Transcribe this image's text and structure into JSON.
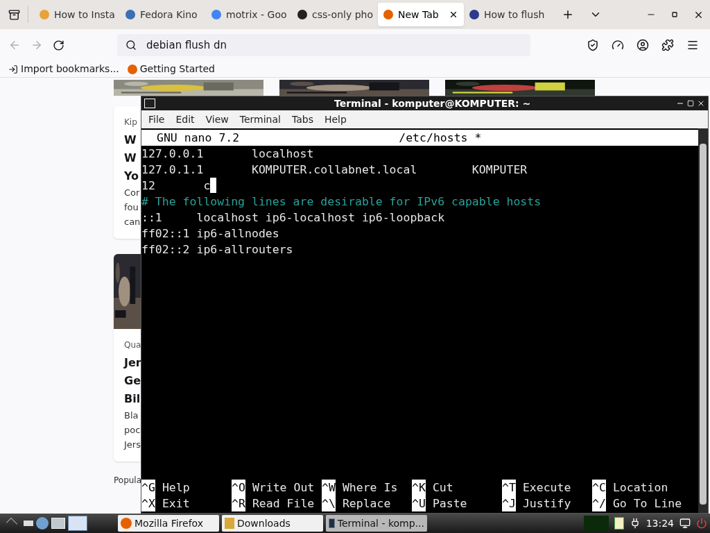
{
  "browser": {
    "tabs": [
      {
        "title": "How to Insta",
        "selected": false,
        "color": "#e8a23a"
      },
      {
        "title": "Fedora Kino",
        "selected": false,
        "color": "#3c6eb4"
      },
      {
        "title": "motrix - Goo",
        "selected": false,
        "color": "#4285f4"
      },
      {
        "title": "css-only pho",
        "selected": false,
        "color": "#222222"
      },
      {
        "title": "New Tab",
        "selected": true,
        "color": "#e66000"
      },
      {
        "title": "How to flush",
        "selected": false,
        "color": "#2b3a8c"
      }
    ],
    "address": {
      "value": "debian flush dn"
    },
    "bookmarks": [
      {
        "label": "Import bookmarks...",
        "kind": "import"
      },
      {
        "label": "Getting Started",
        "kind": "firefox"
      }
    ],
    "cards": [
      {
        "source": "Kip",
        "headline": [
          "W",
          "W",
          "Yo"
        ],
        "body": [
          "Cor",
          "fou",
          "can"
        ]
      },
      {
        "source": "Qua",
        "headline": [
          "Jer",
          "Ge",
          "Bil"
        ],
        "body": [
          "Bla",
          "poc",
          "Jers"
        ]
      }
    ],
    "footer": "Popula"
  },
  "terminal": {
    "title": "Terminal - komputer@KOMPUTER: ~",
    "menu": [
      "File",
      "Edit",
      "View",
      "Terminal",
      "Tabs",
      "Help"
    ],
    "nano": {
      "version": "GNU nano 7.2",
      "filename": "/etc/hosts *",
      "lines": [
        {
          "text": "127.0.0.1       localhost",
          "kind": "text",
          "cursor": false
        },
        {
          "text": "127.0.1.1       KOMPUTER.collabnet.local        KOMPUTER",
          "kind": "text",
          "cursor": false
        },
        {
          "text": "12       c",
          "kind": "text",
          "cursor": true
        },
        {
          "text": "# The following lines are desirable for IPv6 capable hosts",
          "kind": "comment",
          "cursor": false
        },
        {
          "text": "::1     localhost ip6-localhost ip6-loopback",
          "kind": "text",
          "cursor": false
        },
        {
          "text": "ff02::1 ip6-allnodes",
          "kind": "text",
          "cursor": false
        },
        {
          "text": "ff02::2 ip6-allrouters",
          "kind": "text",
          "cursor": false
        }
      ],
      "shortcuts": [
        [
          {
            "key": "^G",
            "label": "Help"
          },
          {
            "key": "^O",
            "label": "Write Out"
          },
          {
            "key": "^W",
            "label": "Where Is"
          },
          {
            "key": "^K",
            "label": "Cut"
          },
          {
            "key": "^T",
            "label": "Execute"
          },
          {
            "key": "^C",
            "label": "Location"
          }
        ],
        [
          {
            "key": "^X",
            "label": "Exit"
          },
          {
            "key": "^R",
            "label": "Read File"
          },
          {
            "key": "^\\",
            "label": "Replace"
          },
          {
            "key": "^U",
            "label": "Paste"
          },
          {
            "key": "^J",
            "label": "Justify"
          },
          {
            "key": "^/",
            "label": "Go To Line"
          }
        ]
      ]
    }
  },
  "taskbar": {
    "tasks": [
      {
        "label": "Mozilla Firefox",
        "selected": false,
        "kind": "firefox"
      },
      {
        "label": "Downloads",
        "selected": false,
        "kind": "folder"
      },
      {
        "label": "Terminal - komp...",
        "selected": true,
        "kind": "terminal"
      }
    ],
    "clock": "13:24"
  }
}
